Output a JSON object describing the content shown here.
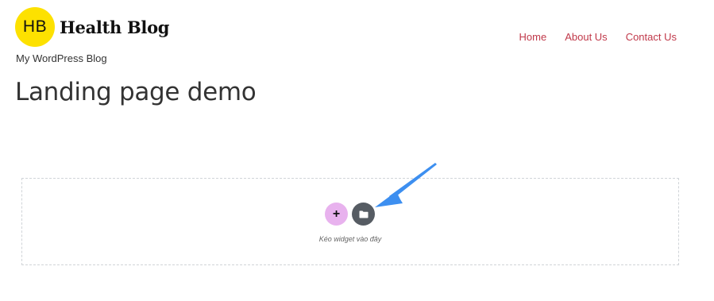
{
  "header": {
    "logo_initials": "HB",
    "site_name": "Health Blog",
    "tagline": "My WordPress Blog"
  },
  "nav": {
    "items": [
      {
        "label": "Home"
      },
      {
        "label": "About Us"
      },
      {
        "label": "Contact Us"
      }
    ]
  },
  "page": {
    "title": "Landing page demo"
  },
  "drop_zone": {
    "add_label": "+",
    "hint": "Kéo widget vào đây"
  },
  "colors": {
    "logo_badge": "#fde100",
    "nav_link": "#c0394a",
    "add_button": "#e8b2ee",
    "template_button": "#565c63",
    "arrow": "#3d8ff0"
  },
  "icons": [
    "plus-icon",
    "folder-icon",
    "pointer-arrow-icon"
  ]
}
